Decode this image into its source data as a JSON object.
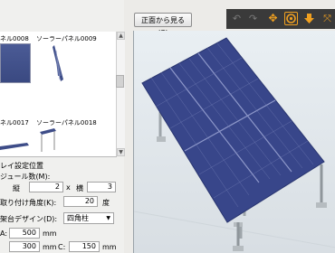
{
  "toolbar": {
    "front_view_label": "正面から見る(G)",
    "icons": [
      "undo-icon",
      "redo-icon",
      "move-icon",
      "rotate-icon",
      "down-arrow-icon",
      "fit-view-icon"
    ]
  },
  "gallery": {
    "items": [
      {
        "label": "ネル0008"
      },
      {
        "label": "ソーラーパネル0009"
      },
      {
        "label": "ネル0017"
      },
      {
        "label": "ソーラーパネル0018"
      }
    ]
  },
  "form": {
    "section_title": "レイ設定位置",
    "module_count_label": "ジュール数(M):",
    "rows_label": "縦",
    "rows_value": "2",
    "times": "x",
    "cols_label": "横",
    "cols_value": "3",
    "angle_label": "取り付け角度(K):",
    "angle_value": "20",
    "angle_unit": "度",
    "stand_label": "架台デザイン(D):",
    "stand_value": "四角柱",
    "a_label": "A:",
    "a_value": "500",
    "a_unit": "mm",
    "b_value": "300",
    "b_unit": "mm",
    "c_label": "C:",
    "c_value": "150",
    "c_unit": "mm"
  },
  "colors": {
    "panel": "#3b4a8c",
    "panel_grid": "#8d97c9",
    "toolbar_bg": "#3a3a3a",
    "accent": "#f0a020"
  }
}
